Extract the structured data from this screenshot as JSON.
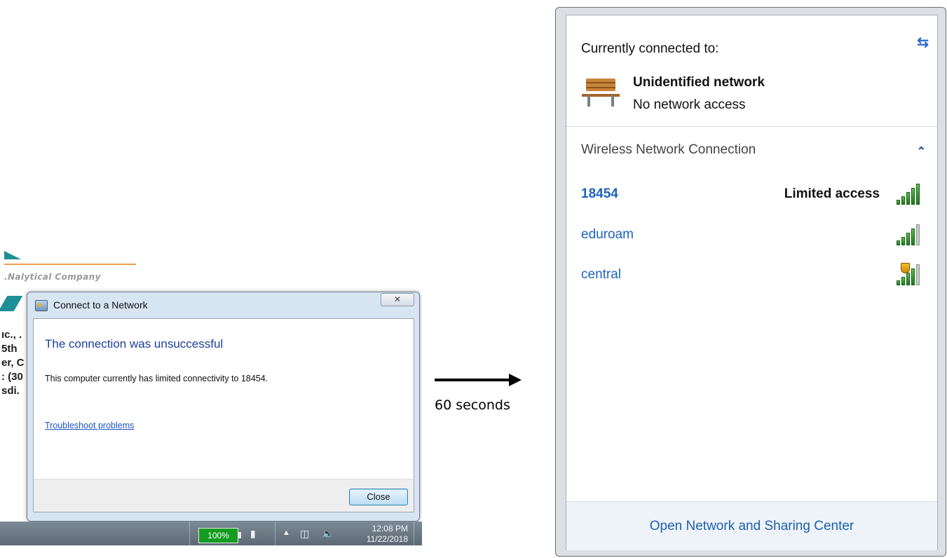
{
  "left_screen": {
    "background_logo_text": ".Nalytical Company",
    "background_text_lines": [
      "ıc., .",
      "5th",
      "er, C",
      ": (30",
      "sdi."
    ]
  },
  "dialog": {
    "title": "Connect to a Network",
    "close_glyph": "✕",
    "heading": "The connection was unsuccessful",
    "message": "This computer currently has limited connectivity to 18454.",
    "troubleshoot_link": "Troubleshoot problems",
    "close_button": "Close"
  },
  "taskbar": {
    "battery": "100%",
    "time": "12:08 PM",
    "date": "11/22/2018"
  },
  "arrow_label": "60 seconds",
  "flyout": {
    "currently_connected": "Currently connected to:",
    "network_name": "Unidentified network",
    "network_status": "No network access",
    "section_title": "Wireless Network Connection",
    "networks": [
      {
        "name": "18454",
        "status": "Limited access",
        "secured_warning": false
      },
      {
        "name": "eduroam",
        "status": "",
        "secured_warning": false
      },
      {
        "name": "central",
        "status": "",
        "secured_warning": true
      }
    ],
    "footer_link": "Open Network and Sharing Center"
  }
}
